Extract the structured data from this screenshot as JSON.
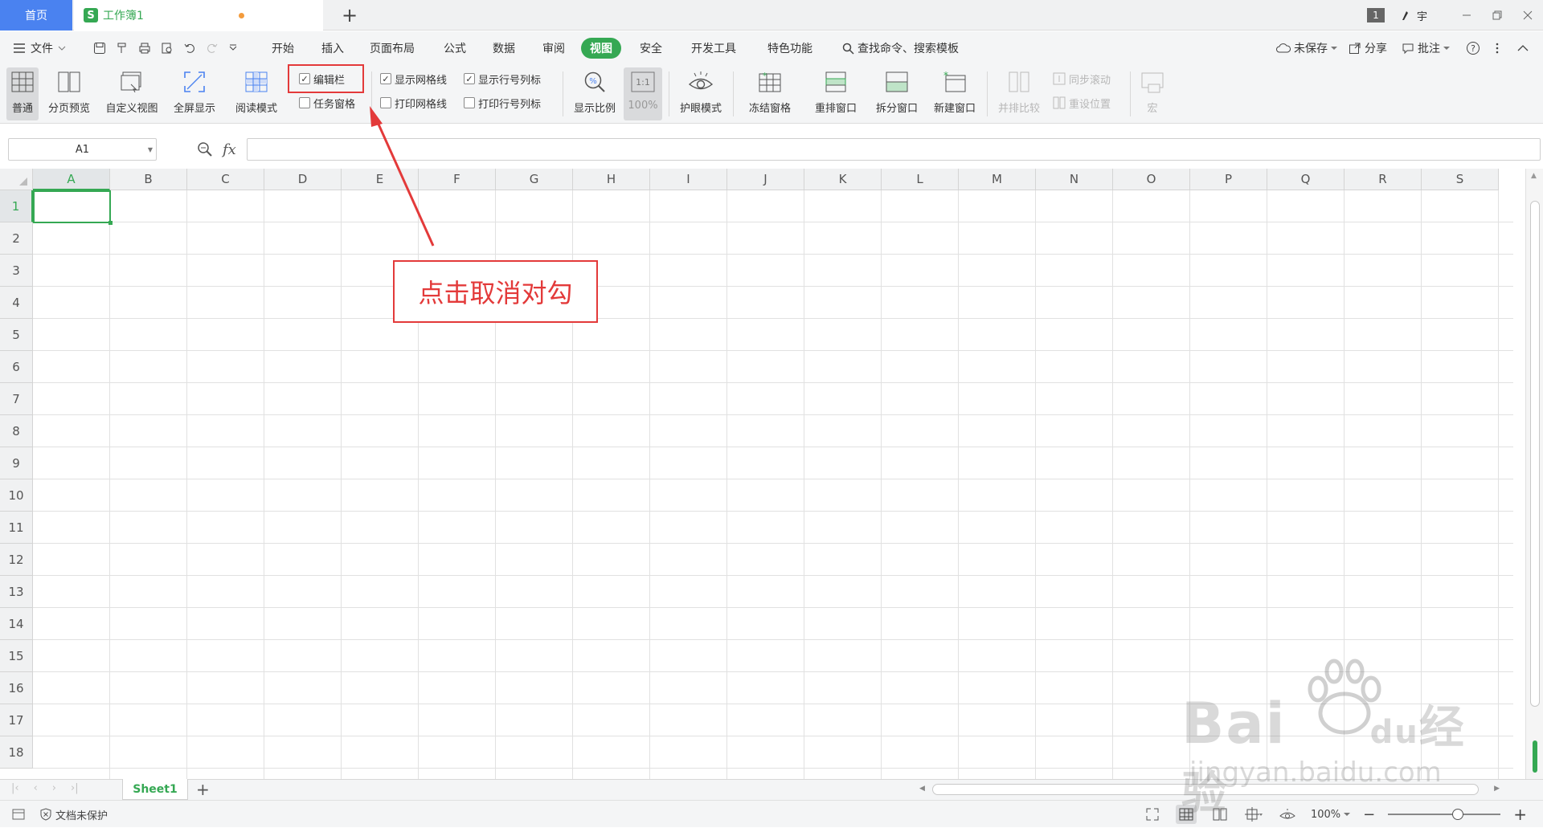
{
  "titlebar": {
    "home_tab": "首页",
    "doc_tab": "工作簿1",
    "doc_logo": "S",
    "new_tab": "+",
    "window_badge": "1",
    "user_name": "宇"
  },
  "menubar": {
    "file": "文件",
    "tabs": [
      "开始",
      "插入",
      "页面布局",
      "公式",
      "数据",
      "审阅",
      "视图",
      "安全",
      "开发工具",
      "特色功能"
    ],
    "active_tab": "视图",
    "search": "查找命令、搜索模板",
    "unsaved": "未保存",
    "share": "分享",
    "comment": "批注"
  },
  "ribbon": {
    "normal": "普通",
    "page_break_preview": "分页预览",
    "custom_view": "自定义视图",
    "fullscreen": "全屏显示",
    "reading_mode": "阅读模式",
    "formula_bar": "编辑栏",
    "task_pane": "任务窗格",
    "show_gridlines": "显示网格线",
    "show_headers": "显示行号列标",
    "print_gridlines": "打印网格线",
    "print_headers": "打印行号列标",
    "zoom": "显示比例",
    "zoom_100": "100%",
    "zoom_100_icon": "1:1",
    "eye_mode": "护眼模式",
    "freeze": "冻结窗格",
    "arrange": "重排窗口",
    "split": "拆分窗口",
    "new_window": "新建窗口",
    "side_by_side": "并排比较",
    "sync_scroll": "同步滚动",
    "reset_position": "重设位置",
    "macro": "宏"
  },
  "formula": {
    "name_box": "A1",
    "fx": "fx"
  },
  "grid": {
    "columns": [
      "A",
      "B",
      "C",
      "D",
      "E",
      "F",
      "G",
      "H",
      "I",
      "J",
      "K",
      "L",
      "M",
      "N",
      "O",
      "P",
      "Q",
      "R",
      "S"
    ],
    "rows": [
      "1",
      "2",
      "3",
      "4",
      "5",
      "6",
      "7",
      "8",
      "9",
      "10",
      "11",
      "12",
      "13",
      "14",
      "15",
      "16",
      "17",
      "18"
    ],
    "selected_cell": "A1"
  },
  "sheets": {
    "active": "Sheet1",
    "add": "+"
  },
  "status": {
    "protect": "文档未保护",
    "zoom": "100%"
  },
  "annotation": {
    "callout": "点击取消对勾",
    "color": "#e33a3a"
  },
  "watermark": {
    "brand": "Bai",
    "brand2": "du",
    "brand_cn": "经验",
    "url": "jingyan.baidu.com"
  },
  "colors": {
    "accent": "#35a853",
    "home_tab": "#4a82f0"
  }
}
